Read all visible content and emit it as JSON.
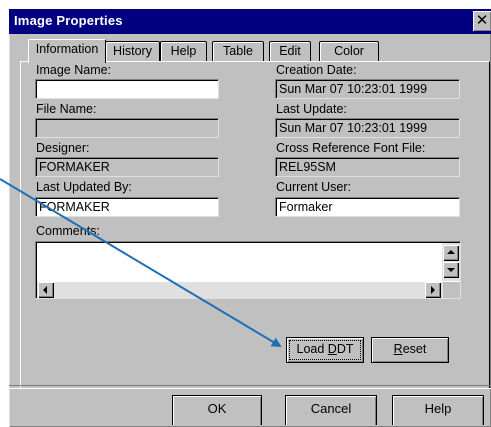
{
  "window": {
    "title": "Image  Properties",
    "close_glyph": "✕"
  },
  "tabs": [
    {
      "label": "Information"
    },
    {
      "label": "History"
    },
    {
      "label": "Help"
    },
    {
      "label": "Table"
    },
    {
      "label": "Edit"
    },
    {
      "label": "Color"
    }
  ],
  "fields": {
    "image_name": {
      "label": "Image Name:",
      "value": ""
    },
    "file_name": {
      "label": "File Name:",
      "value": ""
    },
    "designer": {
      "label": "Designer:",
      "value": "FORMAKER"
    },
    "last_updated_by": {
      "label": "Last Updated By:",
      "value": "FORMAKER"
    },
    "creation_date": {
      "label": "Creation Date:",
      "value": "Sun Mar 07 10:23:01 1999"
    },
    "last_update": {
      "label": "Last Update:",
      "value": "Sun Mar 07 10:23:01 1999"
    },
    "cross_reference_font_file": {
      "label": "Cross Reference Font File:",
      "value": "REL95SM"
    },
    "current_user": {
      "label": "Current User:",
      "value": "Formaker"
    },
    "comments": {
      "label": "Comments:",
      "value": ""
    }
  },
  "buttons": {
    "load_ddt_pre": "Load ",
    "load_ddt_underline": "D",
    "load_ddt_post": "DT",
    "reset_underline": "R",
    "reset_post": "eset",
    "ok": "OK",
    "cancel": "Cancel",
    "help": "Help"
  },
  "annotation": {
    "arrow_color": "#1f6fb5"
  },
  "colors": {
    "title_bar": "#000080",
    "dialog_face": "#c0c0c0"
  }
}
